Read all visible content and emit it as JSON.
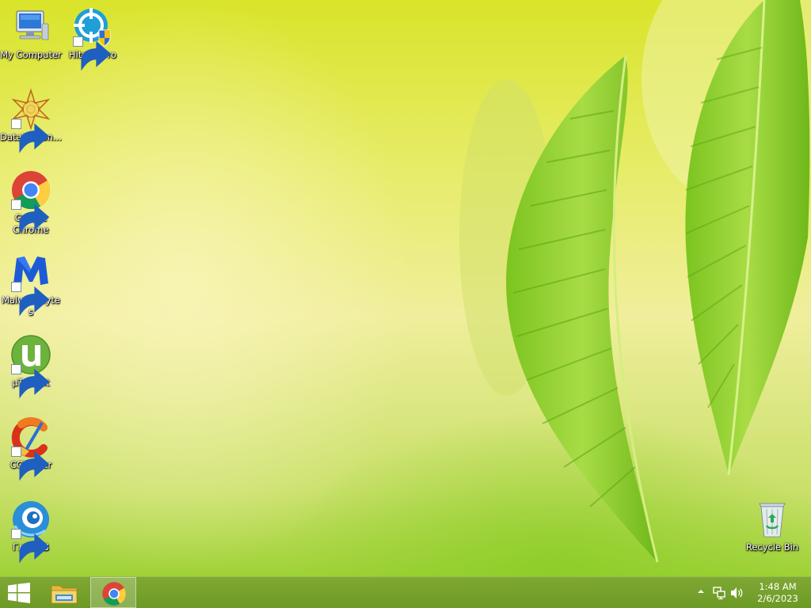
{
  "desktop": {
    "icons": [
      {
        "label": "My Computer",
        "icon": "computer-icon",
        "shortcut": false
      },
      {
        "label": "HitmanPro",
        "icon": "hitmanpro-icon",
        "shortcut": true
      },
      {
        "label": "DataWagon...",
        "icon": "datawagon-icon",
        "shortcut": true
      },
      {
        "label": "Google Chrome",
        "icon": "chrome-icon",
        "shortcut": true
      },
      {
        "label": "Malwarebytes",
        "icon": "malwarebytes-icon",
        "shortcut": true
      },
      {
        "label": "μTorrent",
        "icon": "utorrent-icon",
        "shortcut": true
      },
      {
        "label": "CCleaner",
        "icon": "ccleaner-icon",
        "shortcut": true
      },
      {
        "label": "Глаз.ТВ",
        "icon": "glaz-tv-icon",
        "shortcut": true
      },
      {
        "label": "Recycle Bin",
        "icon": "recycle-bin-icon",
        "shortcut": false
      }
    ]
  },
  "taskbar": {
    "start": {
      "icon": "windows-logo-icon"
    },
    "pinned": [
      {
        "name": "File Explorer",
        "icon": "file-explorer-icon",
        "active": false
      },
      {
        "name": "Google Chrome",
        "icon": "chrome-icon",
        "active": true
      }
    ],
    "tray": {
      "icons": [
        "show-hidden-icons-chevron-icon",
        "network-icon",
        "volume-icon"
      ],
      "time": "1:48 AM",
      "date": "2/6/2023"
    }
  },
  "colors": {
    "taskbar": "#6c9a25",
    "wallpaper_base": "#dde63a",
    "leaf": "#8ccc2e"
  }
}
